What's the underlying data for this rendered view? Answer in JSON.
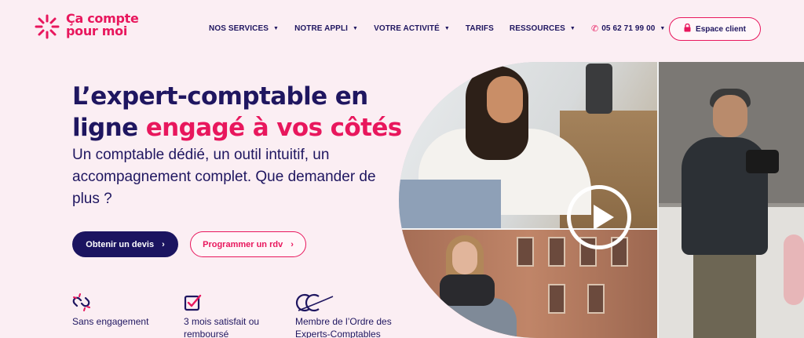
{
  "brand": {
    "name_line1": "Ça compte",
    "name_line2": "pour moi",
    "logo_icon": "sparkle-burst-icon",
    "color": "#e8175d"
  },
  "nav": {
    "items": [
      {
        "label": "NOS SERVICES",
        "has_dropdown": true
      },
      {
        "label": "NOTRE APPLI",
        "has_dropdown": true
      },
      {
        "label": "VOTRE ACTIVITÉ",
        "has_dropdown": true
      },
      {
        "label": "TARIFS",
        "has_dropdown": false
      },
      {
        "label": "RESSOURCES",
        "has_dropdown": true
      }
    ],
    "phone": "05 62 71 99 00",
    "phone_icon": "phone-icon",
    "client_button": "Espace client",
    "client_icon": "lock-icon"
  },
  "hero": {
    "title_part1": "L’expert-comptable en ligne",
    "title_accent": "engagé à vos côtés",
    "subtitle": "Un comptable dédié, un outil intuitif, un accompagnement complet. Que demander de plus ?",
    "primary_button": "Obtenir un devis",
    "secondary_button": "Programmer un rdv"
  },
  "features": [
    {
      "icon": "broken-link-icon",
      "text": "Sans engagement"
    },
    {
      "icon": "checkbox-icon",
      "text": "3 mois satisfait ou remboursé"
    },
    {
      "icon": "ordre-experts-comptables-logo-icon",
      "text": "Membre de l’Ordre des Experts-Comptables"
    }
  ],
  "media": {
    "play_icon": "play-icon"
  },
  "colors": {
    "background": "#fbeef3",
    "navy": "#1f1660",
    "accent": "#e8175d"
  }
}
